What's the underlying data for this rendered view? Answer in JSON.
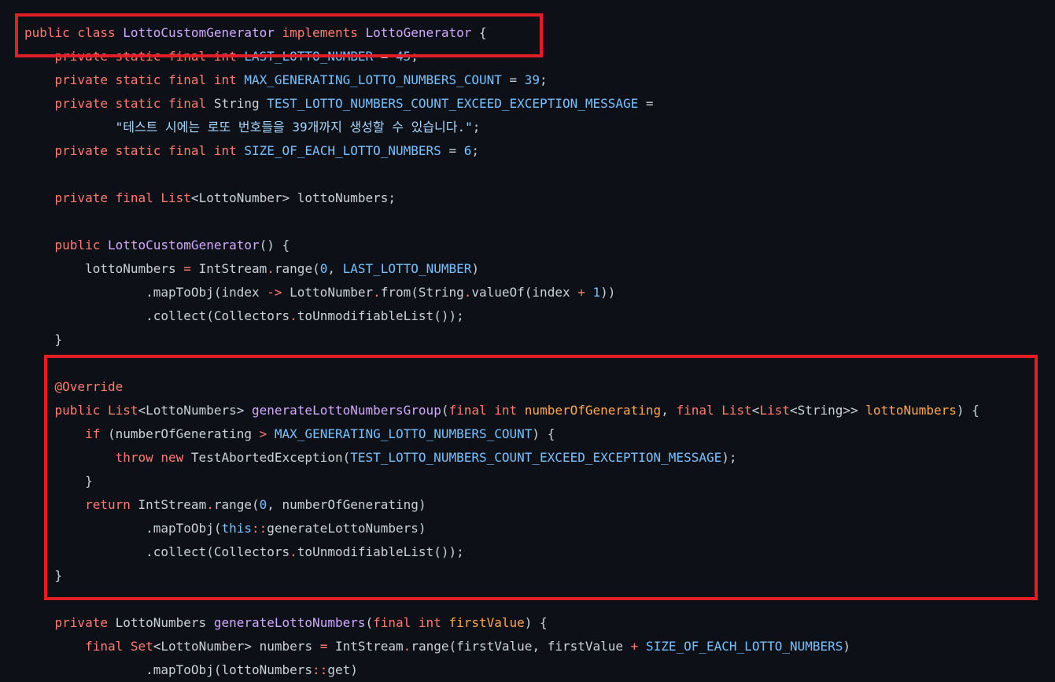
{
  "highlight_color": "#e01e26",
  "code_lines": [
    [
      [
        "public class ",
        "kw"
      ],
      [
        "LottoCustomGenerator",
        "cls"
      ],
      [
        " implements ",
        "kw"
      ],
      [
        "LottoGenerator",
        "cls"
      ],
      [
        " {",
        ""
      ]
    ],
    [
      [
        "    private static final int ",
        "kw"
      ],
      [
        "LAST_LOTTO_NUMBER",
        "cst"
      ],
      [
        " = ",
        ""
      ],
      [
        "45",
        "num"
      ],
      [
        ";",
        ""
      ]
    ],
    [
      [
        "    private static final int ",
        "kw"
      ],
      [
        "MAX_GENERATING_LOTTO_NUMBERS_COUNT",
        "cst"
      ],
      [
        " = ",
        ""
      ],
      [
        "39",
        "num"
      ],
      [
        ";",
        ""
      ]
    ],
    [
      [
        "    private static final ",
        "kw"
      ],
      [
        "String ",
        ""
      ],
      [
        "TEST_LOTTO_NUMBERS_COUNT_EXCEED_EXCEPTION_MESSAGE",
        "cst"
      ],
      [
        " =",
        ""
      ]
    ],
    [
      [
        "            ",
        ""
      ],
      [
        "\"테스트 시에는 로또 번호들을 39개까지 생성할 수 있습니다.\"",
        "str"
      ],
      [
        ";",
        ""
      ]
    ],
    [
      [
        "    private static final int ",
        "kw"
      ],
      [
        "SIZE_OF_EACH_LOTTO_NUMBERS",
        "cst"
      ],
      [
        " = ",
        ""
      ],
      [
        "6",
        "num"
      ],
      [
        ";",
        ""
      ]
    ],
    [],
    [
      [
        "    private final ",
        "kw"
      ],
      [
        "List",
        "kw"
      ],
      [
        "<",
        ""
      ],
      [
        "LottoNumber",
        ""
      ],
      [
        "> ",
        ""
      ],
      [
        "lottoNumbers;",
        ""
      ]
    ],
    [],
    [
      [
        "    public ",
        "kw"
      ],
      [
        "LottoCustomGenerator",
        "fn"
      ],
      [
        "() {",
        ""
      ]
    ],
    [
      [
        "        lottoNumbers ",
        ""
      ],
      [
        "=",
        "op"
      ],
      [
        " IntStream",
        ""
      ],
      [
        ".",
        "op"
      ],
      [
        "range(",
        ""
      ],
      [
        "0",
        "num"
      ],
      [
        ", ",
        ""
      ],
      [
        "LAST_LOTTO_NUMBER",
        "cst"
      ],
      [
        ")",
        ""
      ]
    ],
    [
      [
        "                .mapToObj(index ",
        ""
      ],
      [
        "->",
        "op"
      ],
      [
        " LottoNumber",
        ""
      ],
      [
        ".",
        "op"
      ],
      [
        "from(String",
        ""
      ],
      [
        ".",
        "op"
      ],
      [
        "valueOf(index ",
        ""
      ],
      [
        "+",
        "op"
      ],
      [
        " ",
        ""
      ],
      [
        "1",
        "num"
      ],
      [
        "))",
        ""
      ]
    ],
    [
      [
        "                .collect(Collectors",
        ""
      ],
      [
        ".",
        "op"
      ],
      [
        "toUnmodifiableList());",
        ""
      ]
    ],
    [
      [
        "    }",
        ""
      ]
    ],
    [],
    [
      [
        "    ",
        ""
      ],
      [
        "@Override",
        "annot"
      ]
    ],
    [
      [
        "    public ",
        "kw"
      ],
      [
        "List",
        "kw"
      ],
      [
        "<",
        ""
      ],
      [
        "LottoNumbers",
        ""
      ],
      [
        "> ",
        ""
      ],
      [
        "generateLottoNumbersGroup",
        "fn"
      ],
      [
        "(",
        ""
      ],
      [
        "final int ",
        "kw"
      ],
      [
        "numberOfGenerating",
        "param"
      ],
      [
        ", ",
        ""
      ],
      [
        "final ",
        "kw"
      ],
      [
        "List",
        "kw"
      ],
      [
        "<",
        ""
      ],
      [
        "List",
        "kw"
      ],
      [
        "<",
        ""
      ],
      [
        "String",
        ""
      ],
      [
        ">> ",
        ""
      ],
      [
        "lottoNumbers",
        "param"
      ],
      [
        ") {",
        ""
      ]
    ],
    [
      [
        "        if ",
        "kw"
      ],
      [
        "(numberOfGenerating ",
        ""
      ],
      [
        ">",
        "op"
      ],
      [
        " ",
        ""
      ],
      [
        "MAX_GENERATING_LOTTO_NUMBERS_COUNT",
        "cst"
      ],
      [
        ") {",
        ""
      ]
    ],
    [
      [
        "            throw new ",
        "kw"
      ],
      [
        "TestAbortedException(",
        ""
      ],
      [
        "TEST_LOTTO_NUMBERS_COUNT_EXCEED_EXCEPTION_MESSAGE",
        "cst"
      ],
      [
        ");",
        ""
      ]
    ],
    [
      [
        "        }",
        ""
      ]
    ],
    [
      [
        "        return ",
        "kw"
      ],
      [
        "IntStream",
        ""
      ],
      [
        ".",
        "op"
      ],
      [
        "range(",
        ""
      ],
      [
        "0",
        "num"
      ],
      [
        ", numberOfGenerating)",
        ""
      ]
    ],
    [
      [
        "                .mapToObj(",
        ""
      ],
      [
        "this",
        "cst"
      ],
      [
        "::",
        "op"
      ],
      [
        "generateLottoNumbers)",
        ""
      ]
    ],
    [
      [
        "                .collect(Collectors",
        ""
      ],
      [
        ".",
        "op"
      ],
      [
        "toUnmodifiableList());",
        ""
      ]
    ],
    [
      [
        "    }",
        ""
      ]
    ],
    [],
    [
      [
        "    private ",
        "kw"
      ],
      [
        "LottoNumbers ",
        ""
      ],
      [
        "generateLottoNumbers",
        "fn"
      ],
      [
        "(",
        ""
      ],
      [
        "final int ",
        "kw"
      ],
      [
        "firstValue",
        "param"
      ],
      [
        ") {",
        ""
      ]
    ],
    [
      [
        "        final ",
        "kw"
      ],
      [
        "Set",
        "kw"
      ],
      [
        "<",
        ""
      ],
      [
        "LottoNumber",
        ""
      ],
      [
        "> ",
        ""
      ],
      [
        "numbers ",
        ""
      ],
      [
        "=",
        "op"
      ],
      [
        " IntStream",
        ""
      ],
      [
        ".",
        "op"
      ],
      [
        "range(firstValue, firstValue ",
        ""
      ],
      [
        "+",
        "op"
      ],
      [
        " ",
        ""
      ],
      [
        "SIZE_OF_EACH_LOTTO_NUMBERS",
        "cst"
      ],
      [
        ")",
        ""
      ]
    ],
    [
      [
        "                .mapToObj(lottoNumbers",
        ""
      ],
      [
        "::",
        "op"
      ],
      [
        "get)",
        ""
      ]
    ]
  ]
}
